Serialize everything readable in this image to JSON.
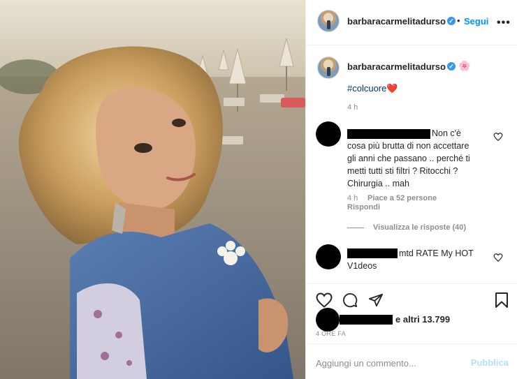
{
  "post": {
    "photo_alt": "",
    "author": "barbaracarmelitadurso",
    "follow_label": "Segui",
    "separator": "•",
    "more_label": "•••"
  },
  "caption": {
    "author": "barbaracarmelitadurso",
    "flower_emoji": "🌸",
    "hashtag": "#colcuore",
    "heart_emoji": "❤️",
    "time": "4 h"
  },
  "comments": [
    {
      "author": "",
      "lines": [
        "Non c'è",
        "cosa più brutta di non accettare",
        "gli anni che passano .. perché ti",
        "metti tutti sti filtri ? Ritocchi ?",
        "Chirurgia .. mah"
      ],
      "time": "4 h",
      "likes": "Piace a 52 persone",
      "reply_label": "Rispondi",
      "view_replies": "Visualizza le risposte (40)"
    },
    {
      "author": "",
      "lines": [
        "mtd RATE My HOT",
        "V1deos"
      ]
    }
  ],
  "likes": {
    "text": "e altri 13.799",
    "time": "4 ORE FA"
  },
  "composer": {
    "placeholder": "Aggiungi un commento...",
    "publish_label": "Pubblica"
  },
  "colors": {
    "link_blue": "#0095f6",
    "verified_blue": "#3897f0",
    "muted": "#8e8e8e",
    "publish_disabled": "#b2dffc"
  }
}
